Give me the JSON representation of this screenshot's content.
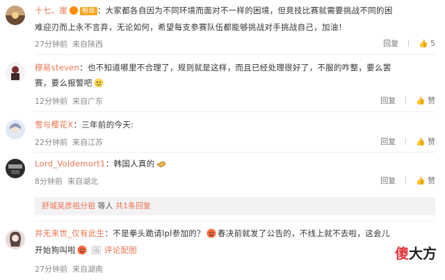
{
  "colors": {
    "username": "#eb7350",
    "meta": "#888888",
    "watermark_red": "#e3353b"
  },
  "comments": [
    {
      "username": "十七、崖",
      "badge": "",
      "text_line1": "大家都各自因为不同环境而面对不一样的困境，但竞技比赛就需要挑战不同的困",
      "text_line2": "难迎刃而上永不言弃，无论如何，希望每支参赛队伍都能够挑战对手挑战自己，加油！",
      "time": "27分钟前",
      "location": "来自陕西",
      "reply_label": "回复",
      "like_count": "5",
      "avatar_icon": "avatar-sunset-icon"
    },
    {
      "username": "穆易steven",
      "text_line1": "也不知道哪里不合理了，规则就是这样，而且已经处理很好了，不服的咋整，要么罢",
      "text_line2": "赛，要么报警吧",
      "time": "12分钟前",
      "location": "来自广东",
      "reply_label": "回复",
      "like_label": "赞",
      "avatar_icon": "avatar-figure-icon"
    },
    {
      "username": "雪与樱花X",
      "text_line1": "三年前的今天:",
      "time": "22分钟前",
      "location": "来自江苏",
      "reply_label": "回复",
      "like_label": "赞",
      "avatar_icon": "avatar-anime-icon"
    },
    {
      "username": "Lord_Voldemort1",
      "text_line1": "韩国人真的",
      "time": "8分钟前",
      "location": "来自湖北",
      "reply_label": "回复",
      "like_label": "赞",
      "avatar_icon": "avatar-dark-icon"
    },
    {
      "username": "井无来世_仅有此生",
      "text_line1a": "不是拳头跪请lpl参加的？",
      "text_line1b": "春决前就发了公告的，不线上就不去啦，这会儿",
      "text_line2": "开始狗叫啦",
      "review_label": "评论配图",
      "time": "27分钟前",
      "location": "来自湖南",
      "reply_label": "回复",
      "like_label": "赞",
      "avatar_icon": "avatar-girl-icon"
    }
  ],
  "subreply": {
    "name": "舒城吴彦祖分祖",
    "text": "等人",
    "link": "共1条回复"
  },
  "watermark": {
    "part1": "傻",
    "part2": "大方"
  }
}
